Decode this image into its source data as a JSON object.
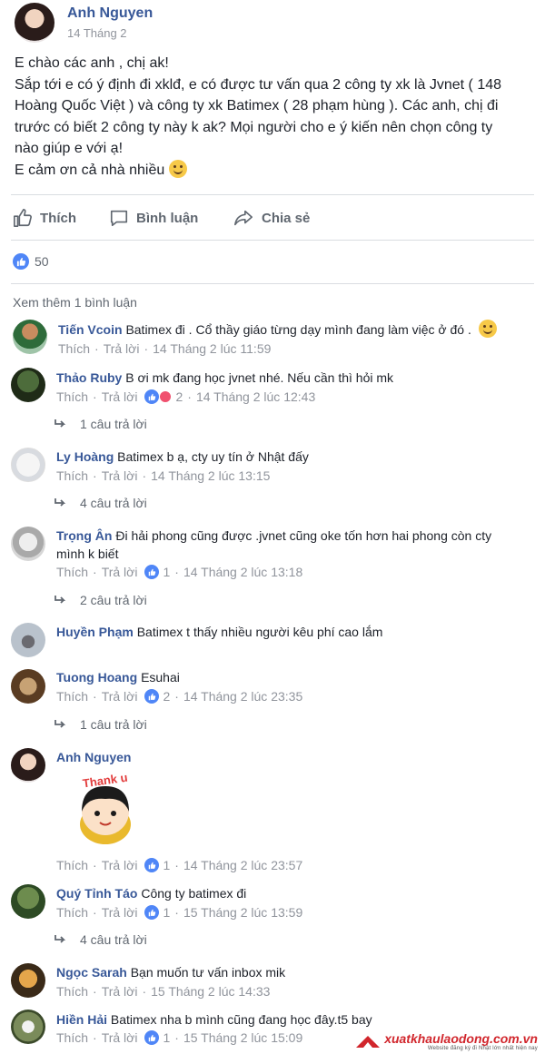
{
  "post": {
    "author": "Anh Nguyen",
    "date": "14 Tháng 2",
    "text_lines": [
      "E chào các anh , chị ak!",
      "Sắp tới e có ý định đi xklđ, e có được tư vấn qua 2 công ty xk là Jvnet ( 148",
      "Hoàng Quốc Việt ) và công ty xk Batimex ( 28 phạm hùng ). Các anh, chị đi",
      "trước có biết 2 công ty này k ak? Mọi người cho e ý kiến nên chọn công ty",
      "nào giúp e với ạ!",
      "E cảm ơn cả nhà nhiều"
    ],
    "actions": {
      "like": "Thích",
      "comment": "Bình luận",
      "share": "Chia sẻ"
    },
    "reaction_count": "50"
  },
  "comments_section": {
    "view_more": "Xem thêm 1 bình luận",
    "comments": [
      {
        "name": "Tiến Vcoin",
        "text": "Batimex đi . Cổ thầy giáo từng dạy mình đang làm việc ở đó .",
        "like": "Thích",
        "reply": "Trả lời",
        "time": "14 Tháng 2 lúc 11:59"
      },
      {
        "name": "Thảo Ruby",
        "text": "B ơi mk đang học jvnet nhé. Nếu cần thì hỏi mk",
        "like": "Thích",
        "reply": "Trả lời",
        "reactions": "2",
        "time": "14 Tháng 2 lúc 12:43",
        "replies": "1 câu trả lời"
      },
      {
        "name": "Ly Hoàng",
        "text": "Batimex b ạ, cty uy tín ở Nhật đấy",
        "like": "Thích",
        "reply": "Trả lời",
        "time": "14 Tháng 2 lúc 13:15",
        "replies": "4 câu trả lời"
      },
      {
        "name": "Trọng Ân",
        "text": "Đi hải phong cũng được .jvnet cũng oke tốn hơn hai phong còn cty",
        "text2": "mình k biết",
        "like": "Thích",
        "reply": "Trả lời",
        "reactions": "1",
        "time": "14 Tháng 2 lúc 13:18",
        "replies": "2 câu trả lời"
      },
      {
        "name": "Huyền Phạm",
        "text": "Batimex t thấy nhiều người kêu phí cao lắm"
      },
      {
        "name": "Tuong Hoang",
        "text": "Esuhai",
        "like": "Thích",
        "reply": "Trả lời",
        "reactions": "2",
        "time": "14 Tháng 2 lúc 23:35",
        "replies": "1 câu trả lời"
      },
      {
        "name": "Anh Nguyen",
        "sticker": "Thank u",
        "like": "Thích",
        "reply": "Trả lời",
        "reactions": "1",
        "time": "14 Tháng 2 lúc 23:57"
      },
      {
        "name": "Quý Tỉnh Táo",
        "text": "Công ty batimex đi",
        "like": "Thích",
        "reply": "Trả lời",
        "reactions": "1",
        "time": "15 Tháng 2 lúc 13:59",
        "replies": "4 câu trả lời"
      },
      {
        "name": "Ngọc Sarah",
        "text": "Bạn muốn tư vấn inbox mik",
        "like": "Thích",
        "reply": "Trả lời",
        "time": "15 Tháng 2 lúc 14:33"
      },
      {
        "name": "Hiền Hải",
        "text": "Batimex nha b mình cũng đang học đây.t5 bay",
        "like": "Thích",
        "reply": "Trả lời",
        "reactions": "1",
        "time": "15 Tháng 2 lúc 15:09"
      }
    ]
  },
  "watermark": {
    "main": "xuatkhaulaodong.com.vn",
    "sub": "Website đăng ký đi Nhật lớn nhất hiện nay"
  },
  "colors": {
    "link": "#385898",
    "meta": "#90949c",
    "like_blue": "#4f86f7",
    "love_red": "#f0506e",
    "watermark_red": "#d1262c"
  }
}
